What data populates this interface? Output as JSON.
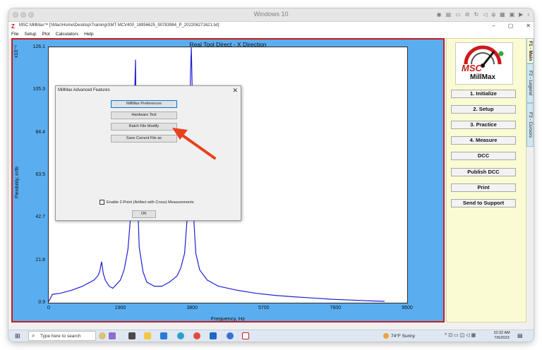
{
  "host": {
    "title": "Windows 10",
    "toolbar_icons": [
      "camera-icon",
      "trash-icon",
      "printer-icon",
      "link-icon",
      "refresh-icon",
      "volume-icon",
      "usb-icon",
      "keyboard-icon",
      "window-icon",
      "video-icon",
      "back-icon"
    ]
  },
  "app": {
    "logo_glyph": "Z",
    "title": "MSC MillMax™ [\\\\Mac\\Home\\Desktop\\Training\\SMT MCV400_18956625_90783984_P_202206271621.txt]",
    "window_controls": [
      "–",
      "▢",
      "✕"
    ],
    "menu": [
      "File",
      "Setup",
      "Plot",
      "Calculators",
      "Help"
    ]
  },
  "plot": {
    "title": "Real Tool Direct - X Direction",
    "y_exponent": "x10⁻⁶",
    "ylabel": "Flexibility, in/lb",
    "xlabel": "Frequency, Hz"
  },
  "chart_data": {
    "type": "line",
    "title": "Real Tool Direct - X Direction",
    "xlabel": "Frequency, Hz",
    "ylabel": "Flexibility, in/lb",
    "y_exponent": "x10⁻⁶",
    "xlim": [
      0,
      9500
    ],
    "ylim": [
      0.9,
      126.1
    ],
    "x_ticks": [
      "0",
      "1900",
      "3800",
      "5700",
      "7600",
      "9500"
    ],
    "y_ticks": [
      "126.1",
      "105.3",
      "84.4",
      "63.5",
      "42.7",
      "21.8",
      "0.9"
    ],
    "grid": false,
    "series": [
      {
        "color": "#1f1fd6",
        "x": [
          0,
          100,
          300,
          600,
          900,
          1100,
          1200,
          1300,
          1350,
          1400,
          1450,
          1500,
          1600,
          1700,
          1800,
          1900,
          2000,
          2100,
          2200,
          2260,
          2300,
          2340,
          2400,
          2500,
          2600,
          2800,
          3000,
          3200,
          3400,
          3500,
          3600,
          3680,
          3720,
          3760,
          3780,
          3800,
          3820,
          3850,
          3900,
          4000,
          4200,
          4500,
          5000,
          5500,
          6000,
          6500,
          7000,
          7500,
          8000,
          8500,
          8900
        ],
        "y": [
          1.5,
          5,
          5.5,
          7,
          9,
          11,
          12,
          14,
          16,
          21,
          15,
          12,
          9,
          8,
          10,
          12,
          17,
          27,
          50,
          90,
          120,
          60,
          28,
          16,
          11,
          9,
          9,
          11,
          14,
          18,
          25,
          45,
          80,
          115,
          126,
          108,
          70,
          40,
          25,
          17,
          12,
          9,
          7,
          5.5,
          4.5,
          3.8,
          3.2,
          2.6,
          2.2,
          1.8,
          1.6
        ]
      }
    ]
  },
  "dialog": {
    "title": "MillMax Advanced Features",
    "close": "✕",
    "buttons": [
      "MillMax Preferences",
      "Hardware Test",
      "Batch File Modify",
      "Save Current File as"
    ],
    "checkbox_label": "Enable 2-Point (Artifact with Cross) Measurements",
    "checkbox_checked": false,
    "ok": "OK",
    "accent_color": "#0078d7",
    "annotation_arrow_color": "#e8401c"
  },
  "side": {
    "brand_msc": "MSC",
    "brand_millmax": "MillMax",
    "buttons": [
      "1. Initialize",
      "2. Setup",
      "3. Practice",
      "4. Measure",
      "DCC",
      "Publish DCC",
      "Print",
      "Send to Support"
    ],
    "tabs": [
      "F1 - Main",
      "F2 - Legend",
      "F3 - Cursors"
    ]
  },
  "taskbar": {
    "search_placeholder": "Type here to search",
    "weather": "74°F  Sunny",
    "time": "10:32 AM",
    "date": "7/6/2023"
  }
}
